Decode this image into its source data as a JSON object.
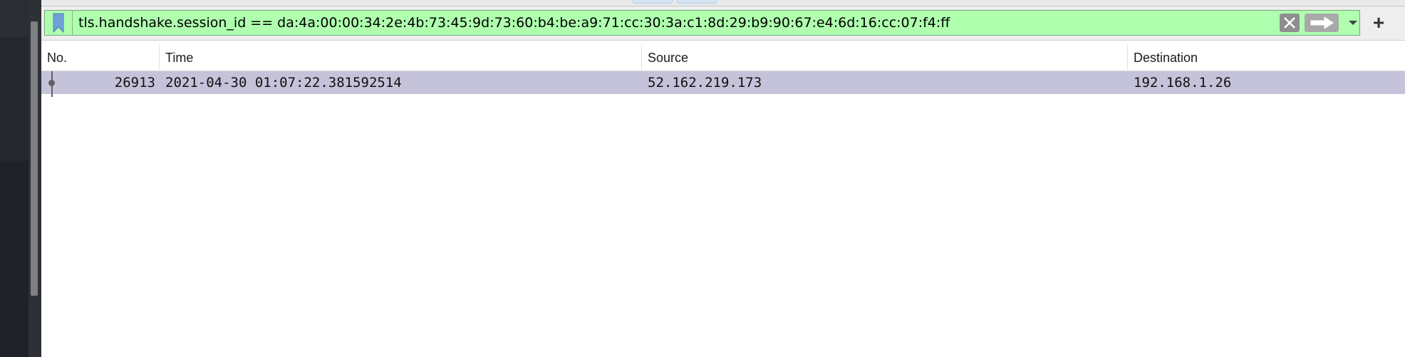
{
  "display_filter": {
    "expression": "tls.handshake.session_id == da:4a:00:00:34:2e:4b:73:45:9d:73:60:b4:be:a9:71:cc:30:3a:c1:8d:29:b9:90:67:e4:6d:16:cc:07:f4:ff",
    "background_color": "#afffaf",
    "add_label": "+"
  },
  "columns": [
    {
      "label": "No."
    },
    {
      "label": "Time"
    },
    {
      "label": "Source"
    },
    {
      "label": "Destination"
    }
  ],
  "packets": [
    {
      "no": "26913",
      "time": "2021-04-30 01:07:22.381592514",
      "source": "52.162.219.173",
      "destination": "192.168.1.26",
      "selected": true,
      "row_color": "#c5c3d9"
    }
  ],
  "icons": {
    "bookmark": "bookmark-icon",
    "clear": "close-icon",
    "apply": "arrow-right-icon",
    "dropdown": "chevron-down-icon",
    "add": "plus-icon"
  }
}
